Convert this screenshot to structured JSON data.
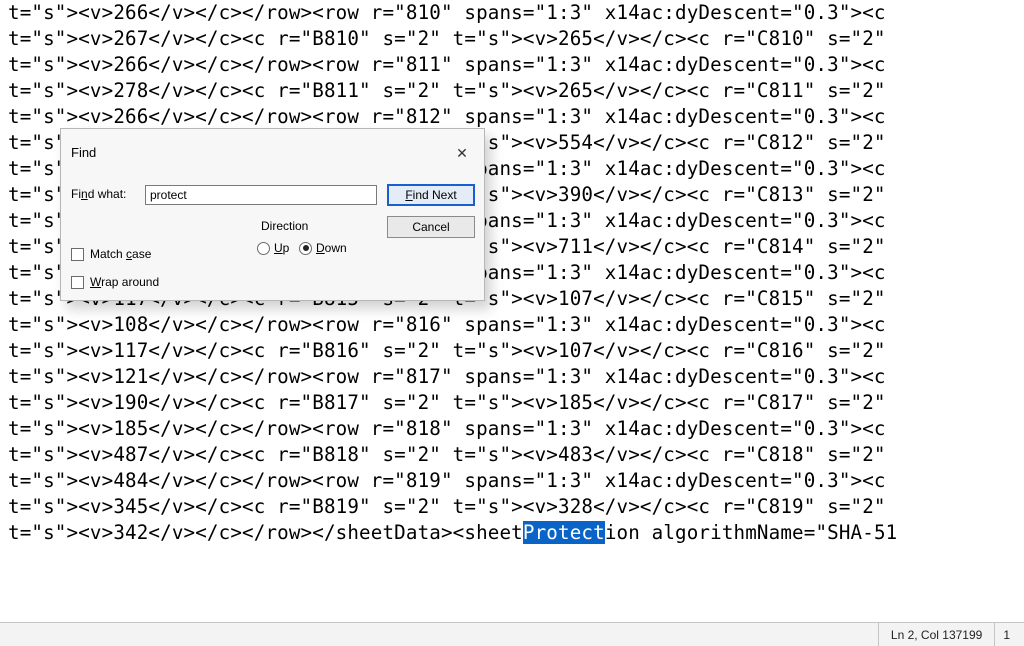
{
  "editor": {
    "lines": [
      "t=\"s\"><v>266</v></c></row><row r=\"810\" spans=\"1:3\" x14ac:dyDescent=\"0.3\"><c",
      "t=\"s\"><v>267</v></c><c r=\"B810\" s=\"2\" t=\"s\"><v>265</v></c><c r=\"C810\" s=\"2\"",
      "t=\"s\"><v>266</v></c></row><row r=\"811\" spans=\"1:3\" x14ac:dyDescent=\"0.3\"><c",
      "t=\"s\"><v>278</v></c><c r=\"B811\" s=\"2\" t=\"s\"><v>265</v></c><c r=\"C811\" s=\"2\"",
      "t=\"s\"><v>266</v></c></row><row r=\"812\" spans=\"1:3\" x14ac:dyDescent=\"0.3\"><c",
      "t=\"s\"><v>555</v></c><c r=\"B812\" s=\"2\" t=\"s\"><v>554</v></c><c r=\"C812\" s=\"2\"",
      "t=\"s\"><v>266</v></c></row><row r=\"813\" spans=\"1:3\" x14ac:dyDescent=\"0.3\"><c",
      "t=\"s\"><v>391</v></c><c r=\"B813\" s=\"2\" t=\"s\"><v>390</v></c><c r=\"C813\" s=\"2\"",
      "t=\"s\"><v>266</v></c></row><row r=\"814\" spans=\"1:3\" x14ac:dyDescent=\"0.3\"><c",
      "t=\"s\"><v>712</v></c><c r=\"B814\" s=\"2\" t=\"s\"><v>711</v></c><c r=\"C814\" s=\"2\"",
      "t=\"s\"><v>712</v></c></row><row r=\"815\" spans=\"1:3\" x14ac:dyDescent=\"0.3\"><c",
      "t=\"s\"><v>117</v></c><c r=\"B815\" s=\"2\" t=\"s\"><v>107</v></c><c r=\"C815\" s=\"2\"",
      "t=\"s\"><v>108</v></c></row><row r=\"816\" spans=\"1:3\" x14ac:dyDescent=\"0.3\"><c",
      "t=\"s\"><v>117</v></c><c r=\"B816\" s=\"2\" t=\"s\"><v>107</v></c><c r=\"C816\" s=\"2\"",
      "t=\"s\"><v>121</v></c></row><row r=\"817\" spans=\"1:3\" x14ac:dyDescent=\"0.3\"><c",
      "t=\"s\"><v>190</v></c><c r=\"B817\" s=\"2\" t=\"s\"><v>185</v></c><c r=\"C817\" s=\"2\"",
      "t=\"s\"><v>185</v></c></row><row r=\"818\" spans=\"1:3\" x14ac:dyDescent=\"0.3\"><c",
      "t=\"s\"><v>487</v></c><c r=\"B818\" s=\"2\" t=\"s\"><v>483</v></c><c r=\"C818\" s=\"2\"",
      "t=\"s\"><v>484</v></c></row><row r=\"819\" spans=\"1:3\" x14ac:dyDescent=\"0.3\"><c",
      "t=\"s\"><v>345</v></c><c r=\"B819\" s=\"2\" t=\"s\"><v>328</v></c><c r=\"C819\" s=\"2\""
    ],
    "last_line": {
      "pre": "t=\"s\"><v>342</v></c></row></sheetData><sheet",
      "highlight": "Protect",
      "post": "ion algorithmName=\"SHA-51"
    }
  },
  "status": {
    "pos": "Ln 2, Col 137199",
    "extra": "1"
  },
  "find_dialog": {
    "title": "Find",
    "find_what_label": "Find what:",
    "input_value": "protect",
    "find_next": "Find Next",
    "cancel": "Cancel",
    "direction_label": "Direction",
    "up_label": "Up",
    "down_label": "Down",
    "direction_selected": "down",
    "match_case": {
      "label": "Match case",
      "checked": false
    },
    "wrap_around": {
      "label": "Wrap around",
      "checked": false
    }
  }
}
